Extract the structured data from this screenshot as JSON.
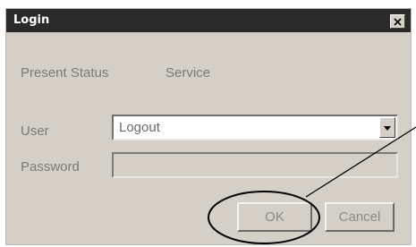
{
  "dialog": {
    "title": "Login",
    "close_icon": "close-icon"
  },
  "status": {
    "label": "Present Status",
    "value": "Service"
  },
  "user": {
    "label": "User",
    "value": "Logout",
    "dropdown_icon": "chevron-down-icon"
  },
  "password": {
    "label": "Password",
    "value": ""
  },
  "buttons": {
    "ok_label": "OK",
    "cancel_label": "Cancel"
  },
  "annotation": {
    "callout_color": "#000000"
  }
}
